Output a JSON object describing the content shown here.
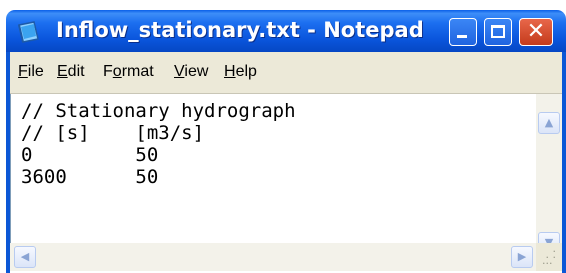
{
  "window": {
    "title": "Inflow_stationary.txt - Notepad",
    "app_icon": "notepad-icon",
    "buttons": {
      "minimize": "minimize-icon",
      "maximize": "maximize-icon",
      "close": "✕"
    }
  },
  "menu": {
    "file": "File",
    "edit": "Edit",
    "format": "Format",
    "view": "View",
    "help": "Help"
  },
  "document": {
    "lines": [
      "// Stationary hydrograph",
      "// [s]    [m3/s]",
      "0         50",
      "3600      50"
    ]
  },
  "colors": {
    "title_bar": "#0a55dc",
    "close_button": "#c43b1c",
    "menu_bg": "#ece9d8"
  }
}
